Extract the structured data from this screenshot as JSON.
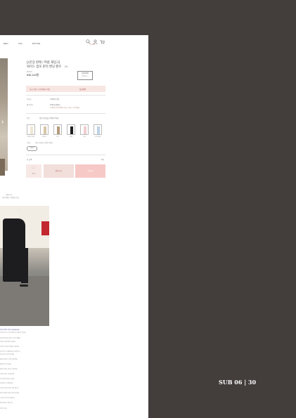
{
  "nav": {
    "items": [
      "BEST",
      "OPS",
      "BOTTOM"
    ]
  },
  "header": {
    "icons": [
      "search-icon",
      "user-icon",
      "cart-icon"
    ],
    "login_label": "LOGIN"
  },
  "product": {
    "title": "[1만장 판매 / 여름 재입고]",
    "subtitle": "와이드 컴포 핀턱 밴딩 팬츠",
    "count": "3/4",
    "brand": "MOON",
    "price": "¥36,140원",
    "coupon_label": "COUPON",
    "coupon_sub": "쿠폰받기 ↓",
    "benefit_left": "신규 가입 시 무료배송+적립",
    "benefit_right": "회원혜택",
    "rows": [
      {
        "label": "적립금",
        "value": "1,800원 적립"
      },
      {
        "label": "배송방법",
        "value": "택배(국내배송)",
        "value2": "3,000원 (50,000원 이상 구매 시 무료배송)"
      }
    ],
    "color_label": "색상",
    "color_value": "[필수] 옵션을 선택해 주세요",
    "swatches": [
      {
        "name": "크림아이보리",
        "color": "#efe6d4"
      },
      {
        "name": "베이지",
        "color": "#d8c6a8"
      },
      {
        "name": "모카",
        "color": "#b49a7c"
      },
      {
        "name": "블랙",
        "color": "#1e1e1e"
      },
      {
        "name": "핑크",
        "color": "#f0cdd0"
      },
      {
        "name": "스카이블루",
        "color": "#bcd2e6"
      }
    ],
    "size_label": "사이즈",
    "size_value": "[필수] 옵션을 선택해 주세요",
    "size_option": "FREE",
    "total_label": "총 금액",
    "total_value": "0원",
    "wish_label": "찜하기",
    "cart_label": "장바구니",
    "buy_label": "구매하기"
  },
  "review": {
    "caption": "구매 후기",
    "caption_sub": "리뷰 작성 시 적립금 지급",
    "lines": [
      "리뷰 작성자 아이디 ★★★★★",
      "작년에 사고 또 삼 계절 지날 때마다 입어요",
      "허리 밴딩이라 편하고 핏이 예뻐요",
      "색감이 사진이랑 똑같아요",
      "기장도 딱 좋고 여름에 시원해요",
      "여러 컬러 구매했어요 추천합니다",
      "출근룩으로 입기 좋네요",
      "배송도 빠르고 포장 깔끔해요",
      "재질이 부드러워요",
      "세탁 후에도 늘어나지 않아요",
      "부모님 것도 사드렸어요",
      "가격 대비 만족스러워요",
      "다음에 또 구매할게요",
      "사이즈 정사이즈로 가면 됩니다",
      "핀턱 덕분에 다리가 길어 보여요",
      "구김이 잘 안가서 좋아요",
      "재구매 의사 있습니다",
      "리뷰 더보기"
    ]
  },
  "page_label": "SUB 06 | 30"
}
